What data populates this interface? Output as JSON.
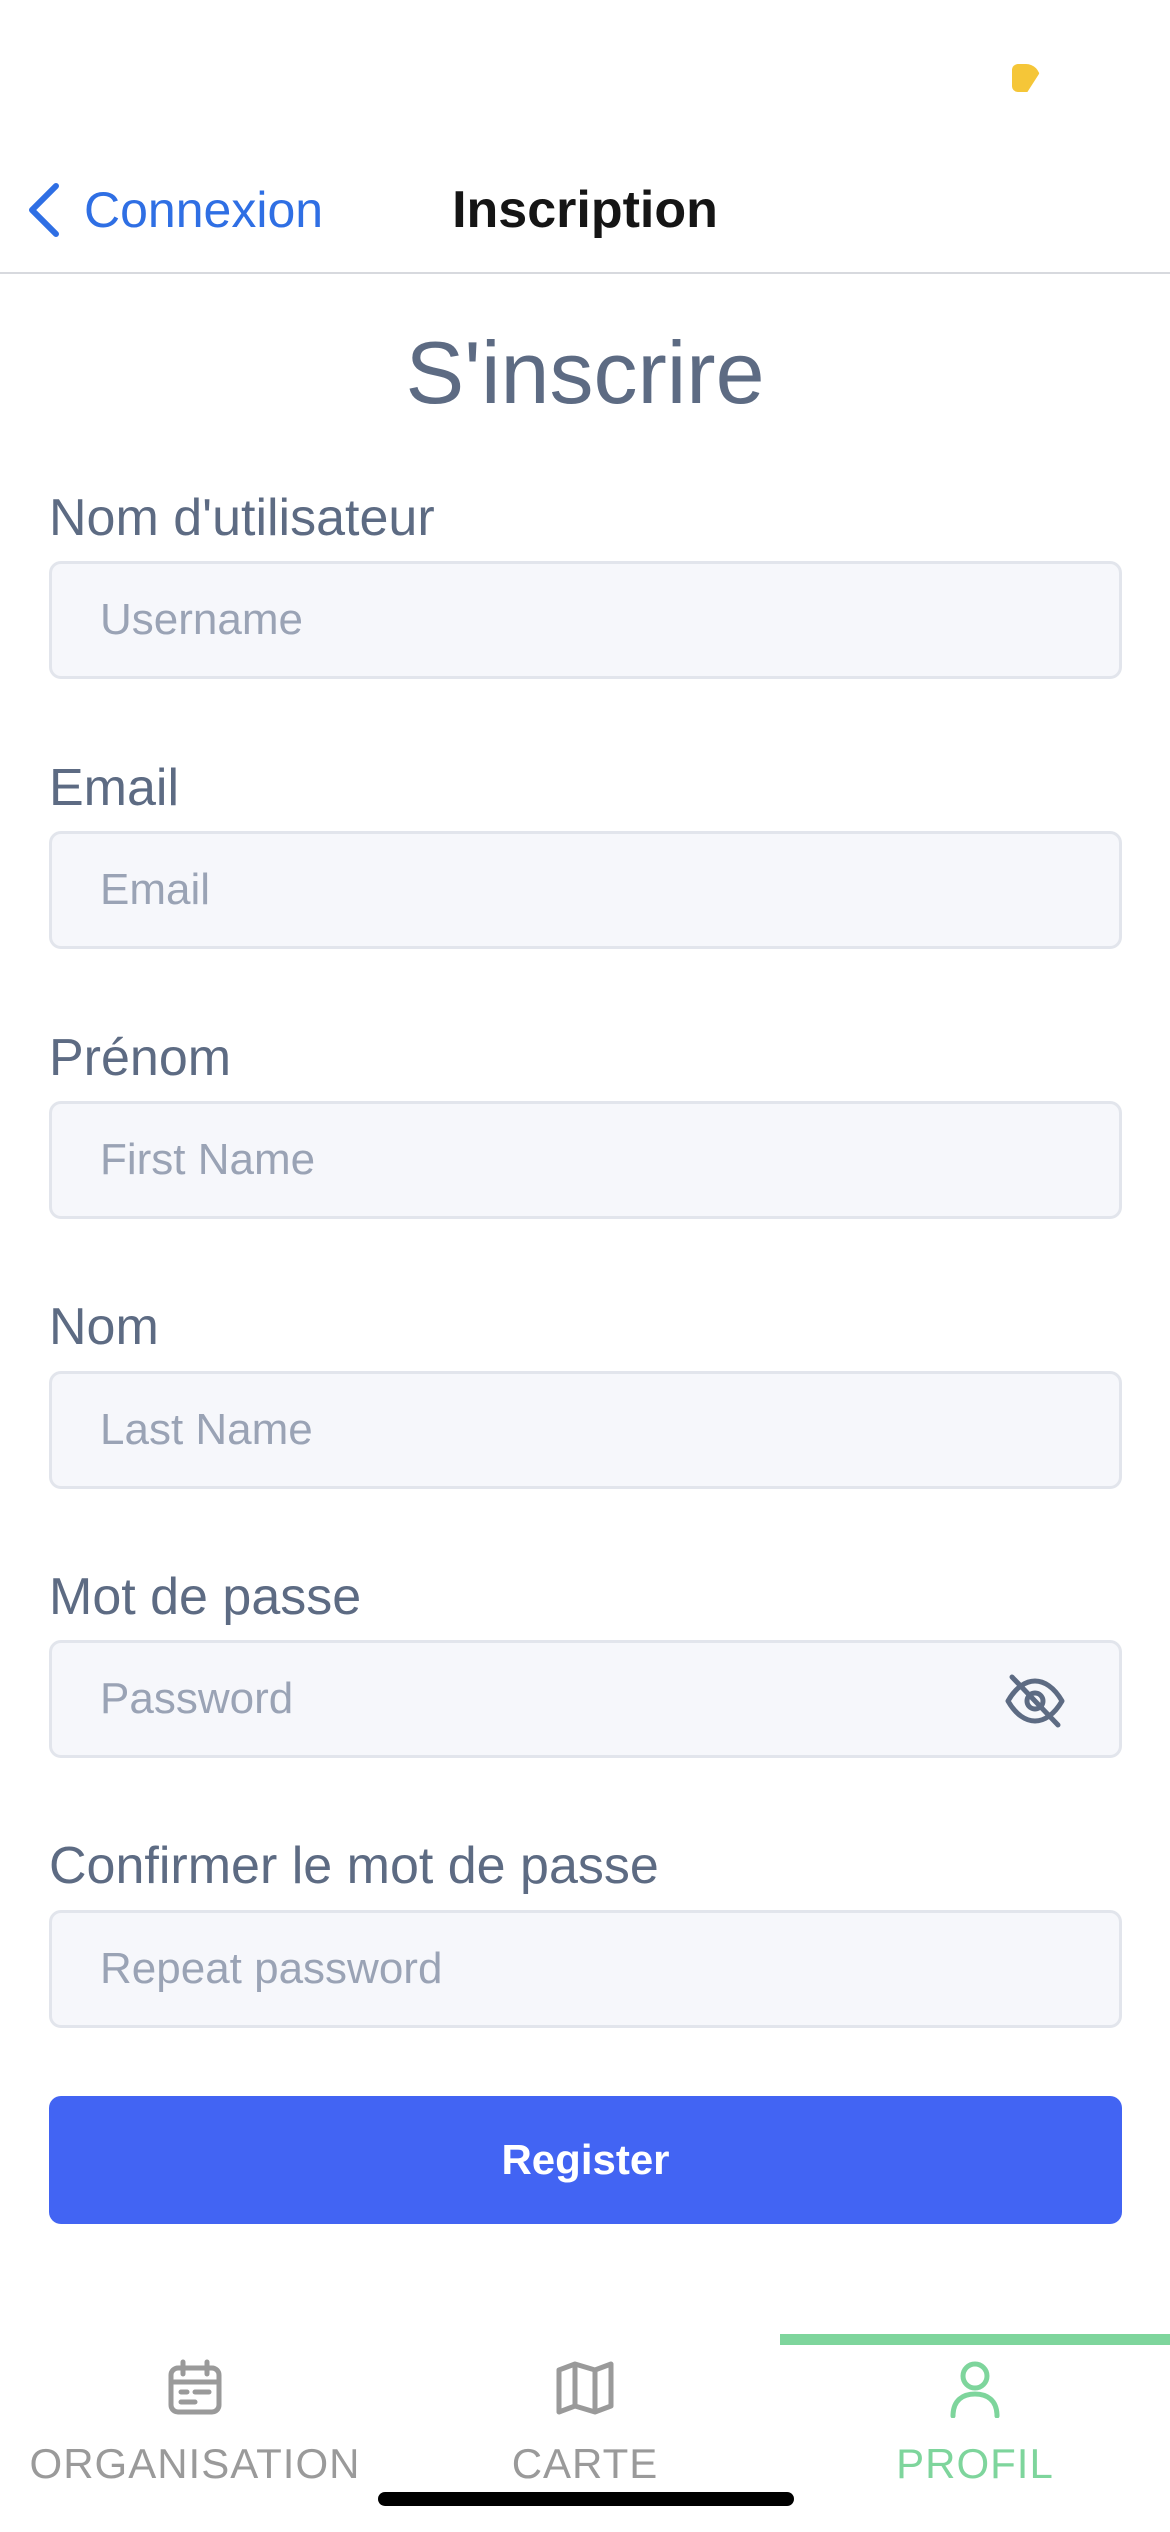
{
  "header": {
    "back_label": "Connexion",
    "title": "Inscription"
  },
  "form": {
    "title": "S'inscrire",
    "fields": [
      {
        "label": "Nom d'utilisateur",
        "placeholder": "Username",
        "value": ""
      },
      {
        "label": "Email",
        "placeholder": "Email",
        "value": ""
      },
      {
        "label": "Prénom",
        "placeholder": "First Name",
        "value": ""
      },
      {
        "label": "Nom",
        "placeholder": "Last Name",
        "value": ""
      },
      {
        "label": "Mot de passe",
        "placeholder": "Password",
        "value": "",
        "toggle_icon": "eye-off-icon"
      },
      {
        "label": "Confirmer le mot de passe",
        "placeholder": "Repeat password",
        "value": ""
      }
    ],
    "submit_label": "Register"
  },
  "tabs": [
    {
      "label": "ORGANISATION",
      "icon": "calendar-icon",
      "active": false
    },
    {
      "label": "CARTE",
      "icon": "map-icon",
      "active": false
    },
    {
      "label": "PROFIL",
      "icon": "user-icon",
      "active": true
    }
  ],
  "colors": {
    "accent_link": "#2f6fe4",
    "primary_button": "#4264f3",
    "active_tab": "#7ed59c",
    "inactive_tab": "#9a9a9a",
    "text_label": "#5d6b83"
  }
}
